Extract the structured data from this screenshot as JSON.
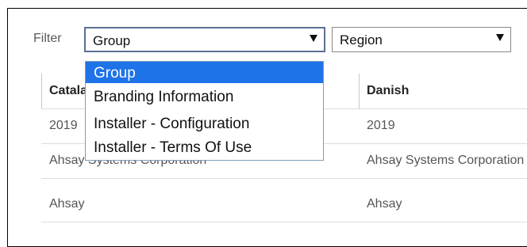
{
  "filter": {
    "label": "Filter",
    "group_select": {
      "value": "Group"
    },
    "region_select": {
      "value": "Region"
    }
  },
  "dropdown": {
    "options": [
      {
        "label": "Group",
        "selected": true
      },
      {
        "label": "Branding Information",
        "selected": false
      },
      {
        "label": "Installer - Configuration",
        "selected": false
      },
      {
        "label": "Installer - Terms Of Use",
        "selected": false
      }
    ]
  },
  "table": {
    "columns": [
      "Catalan",
      "Danish"
    ],
    "rows": [
      [
        "2019",
        "2019"
      ],
      [
        "Ahsay Systems Corporation",
        "Ahsay Systems Corporation"
      ],
      [
        "Ahsay",
        "Ahsay"
      ]
    ]
  },
  "colors": {
    "selected_option_bg": "#1e73e8",
    "select_border_active": "#5b6f94",
    "panel_border": "#000000"
  }
}
